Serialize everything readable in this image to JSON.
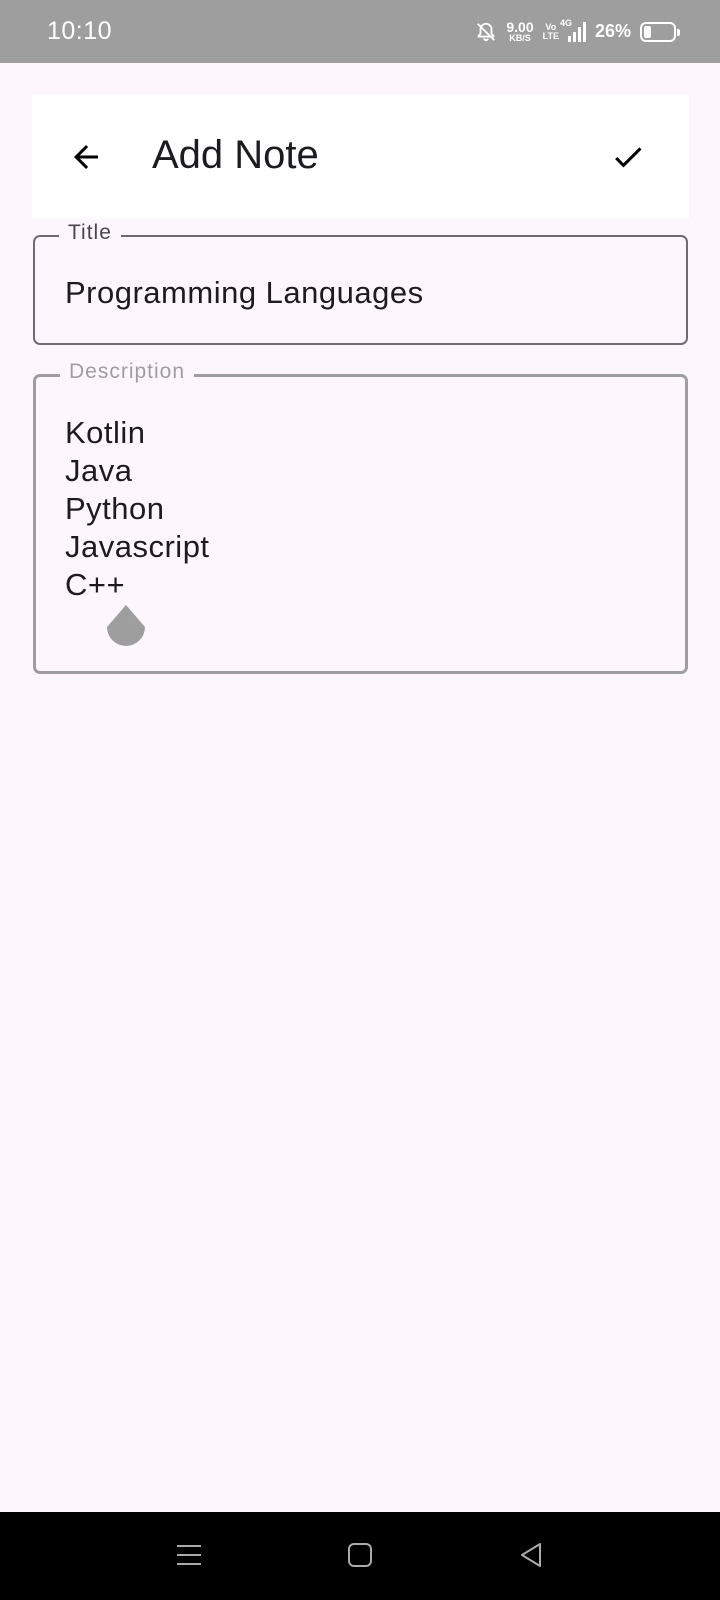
{
  "status_bar": {
    "time": "10:10",
    "speed_value": "9.00",
    "speed_unit": "KB/S",
    "volte_top": "Vo",
    "volte_bottom": "LTE",
    "network": "4G",
    "battery_percent": "26%",
    "battery_level": 0.26
  },
  "app_bar": {
    "title": "Add Note",
    "back_icon": "arrow-back-icon",
    "save_icon": "check-icon"
  },
  "form": {
    "title_label": "Title",
    "title_value": "Programming Languages",
    "description_label": "Description",
    "description_lines": [
      "Kotlin",
      "Java",
      "Python",
      "Javascript",
      "C++"
    ]
  },
  "nav_bar": {
    "icons": [
      "menu-icon",
      "home-icon",
      "back-icon"
    ]
  },
  "colors": {
    "background": "#fdf7fd",
    "status_bar": "#9e9e9e",
    "app_bar": "#ffffff",
    "text": "#1d1b20",
    "outline_title": "#6f6a74",
    "outline_description": "#9e9e9e"
  }
}
